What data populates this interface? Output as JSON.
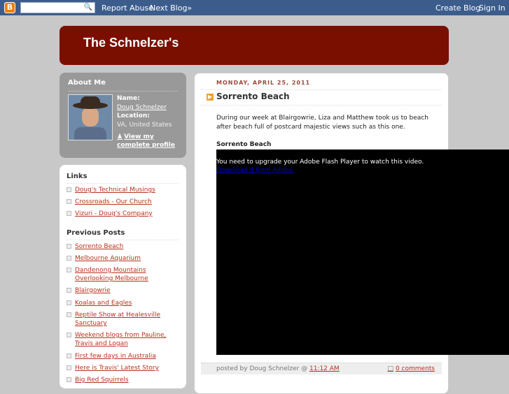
{
  "navbar": {
    "logo_letter": "B",
    "search_icon": "magnifier-icon",
    "report_abuse": "Report Abuse",
    "next_blog": "Next Blog»",
    "create_blog": "Create Blog",
    "sign_in": "Sign In"
  },
  "header": {
    "title": "The Schnelzer's"
  },
  "about": {
    "heading": "About Me",
    "name_label": "Name:",
    "name_value": "Doug Schnelzer",
    "location_label": "Location:",
    "location_value": "VA, United States",
    "view_profile": "View my complete profile"
  },
  "links": {
    "heading": "Links",
    "items": [
      "Doug's Technical Musings",
      "Crossroads - Our Church",
      "Vizuri - Doug's Company"
    ]
  },
  "previous_posts": {
    "heading": "Previous Posts",
    "items": [
      "Sorrento Beach",
      "Melbourne Aquarium",
      "Dandenong Mountains Overlooking Melbourne",
      "Blairgowrie",
      "Koalas and Eagles",
      "Reptile Show at Healesville Sanctuary",
      "Weekend blogs from Pauline, Travis and Logan",
      "First few days in Australia",
      "Here is Travis' Latest Story",
      "Big Red Squirrels"
    ]
  },
  "post": {
    "date": "Monday, April 25, 2011",
    "title": "Sorrento Beach",
    "body": "During our week at Blairgowrie, Liza and Matthew took us to beach after beach full of postcard majestic views such as this one.",
    "subtitle": "Sorrento Beach",
    "video_message": "You need to upgrade your Adobe Flash Player to watch this video.",
    "video_link": "Download it from Adobe.",
    "footer_posted_by": "posted by Doug Schnelzer @",
    "footer_time": "11:12 AM",
    "footer_comments": "0 comments"
  },
  "colors": {
    "navbar": "#3c5d8c",
    "header": "#7a0f00",
    "link": "#b6321d",
    "background": "#c8c8c8"
  }
}
